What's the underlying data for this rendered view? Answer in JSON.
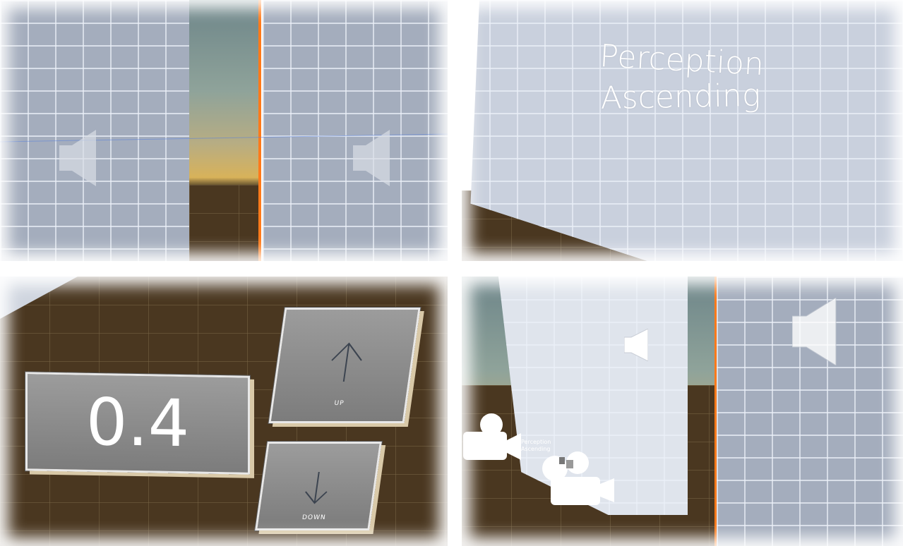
{
  "views": {
    "top_left": {
      "description_name": "speaker-walls-view"
    },
    "top_right": {
      "wall_title_line1": "Perception",
      "wall_title_line2": "Ascending"
    },
    "bottom_left": {
      "value_display": "0.4",
      "up_button_label": "UP",
      "down_button_label": "DOWN"
    },
    "bottom_right": {
      "camera_label_line1": "Perception",
      "camera_label_line2": "Ascending"
    }
  },
  "icons": {
    "speaker": "speaker-icon",
    "up_arrow": "arrow-up-icon",
    "down_arrow": "arrow-down-icon",
    "camera": "camera-icon"
  },
  "colors": {
    "accent_orange": "#ff7a1a",
    "floor_brown": "#4a3720",
    "wall_grey": "#a4adbd",
    "panel_grey": "#8c8c8c"
  }
}
